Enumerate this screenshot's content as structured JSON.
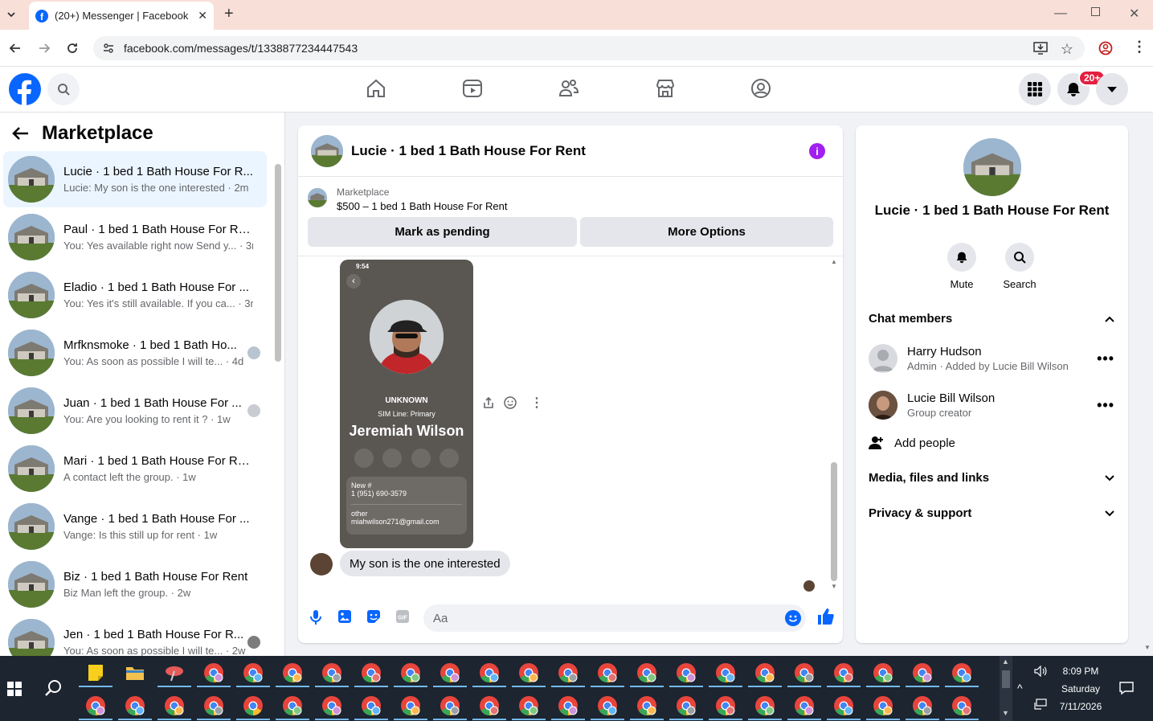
{
  "browser": {
    "tab_title": "(20+) Messenger | Facebook",
    "url": "facebook.com/messages/t/1338877234447543"
  },
  "header": {
    "notification_badge": "20+"
  },
  "sidebar": {
    "title": "Marketplace",
    "chats": [
      {
        "name": "Lucie · 1 bed 1 Bath House For R...",
        "preview": "Lucie: My son is the one interested · 2m",
        "active": true
      },
      {
        "name": "Paul · 1 bed 1 Bath House For Rent",
        "preview": "You: Yes available right now Send y... · 3m"
      },
      {
        "name": "Eladio · 1 bed 1 Bath House For ...",
        "preview": "You: Yes it's still available. If you ca... · 3m"
      },
      {
        "name": "Mrfknsmoke · 1 bed 1 Bath Ho...",
        "preview": "You: As soon as possible I will te... · 4d"
      },
      {
        "name": "Juan · 1 bed 1 Bath House For ...",
        "preview": "You: Are you looking to rent it ? · 1w"
      },
      {
        "name": "Mari · 1 bed 1 Bath House For Re...",
        "preview": "A contact left the group. · 1w"
      },
      {
        "name": "Vange · 1 bed 1 Bath House For ...",
        "preview": "Vange: Is this still up for rent · 1w"
      },
      {
        "name": "Biz · 1 bed 1 Bath House For Rent",
        "preview": "Biz Man left the group. · 2w"
      },
      {
        "name": "Jen · 1 bed 1 Bath House For R...",
        "preview": "You: As soon as possible I will te... · 2w"
      }
    ]
  },
  "conversation": {
    "title": "Lucie · 1 bed 1 Bath House For Rent",
    "marketplace_label": "Marketplace",
    "listing": "$500 – 1 bed 1 Bath House For Rent",
    "mark_pending": "Mark as pending",
    "more_options": "More Options",
    "screenshot": {
      "time": "9:54",
      "unknown": "UNKNOWN",
      "sim": "SIM Line: Primary",
      "contact_name": "Jeremiah Wilson",
      "new_label": "New #",
      "new_number": "1 (951) 690-3579",
      "other_label": "other",
      "other_email": "miahwilson271@gmail.com"
    },
    "message": "My son is the one interested",
    "input_placeholder": "Aa"
  },
  "details": {
    "name": "Lucie · 1 bed 1 Bath House For Rent",
    "mute": "Mute",
    "search": "Search",
    "chat_members": "Chat members",
    "members": [
      {
        "name": "Harry Hudson",
        "sub": "Admin · Added by Lucie Bill Wilson"
      },
      {
        "name": "Lucie Bill Wilson",
        "sub": "Group creator"
      }
    ],
    "add_people": "Add people",
    "media": "Media, files and links",
    "privacy": "Privacy & support"
  },
  "taskbar": {
    "time": "8:09 PM",
    "day": "Saturday",
    "date": "7/11/2026"
  },
  "colors": {
    "fb_blue": "#0866ff",
    "badge_red": "#e41e3f",
    "info_purple": "#a020f0"
  }
}
